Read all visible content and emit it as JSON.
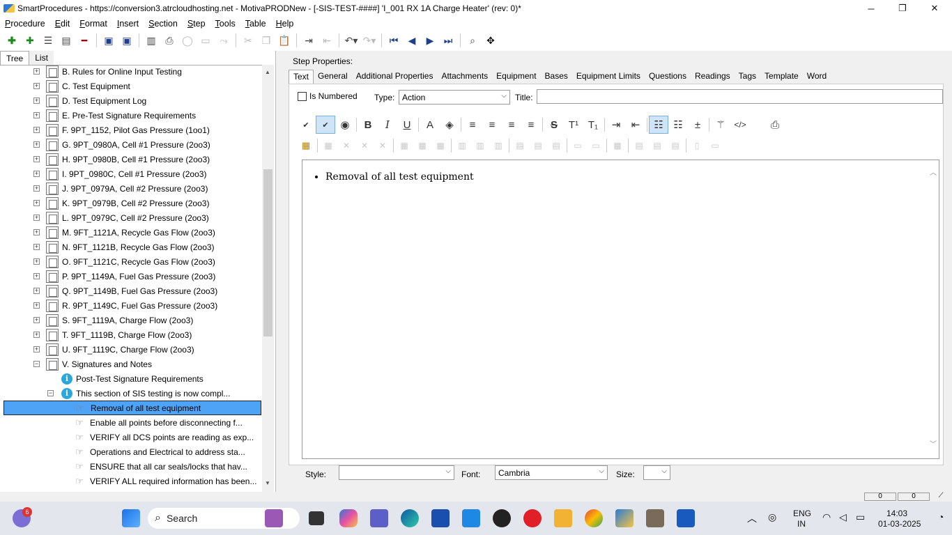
{
  "window": {
    "title": "SmartProcedures - https://conversion3.atrcloudhosting.net - MotivaPRODNew - [-SIS-TEST-####] 'I_001 RX 1A Charge Heater' (rev: 0)*",
    "minimize": "─",
    "restore": "❐",
    "close": "✕"
  },
  "menu": [
    {
      "first": "P",
      "rest": "rocedure"
    },
    {
      "first": "E",
      "rest": "dit"
    },
    {
      "first": "F",
      "rest": "ormat"
    },
    {
      "first": "I",
      "rest": "nsert"
    },
    {
      "first": "S",
      "rest": "ection"
    },
    {
      "first": "S",
      "rest": "tep"
    },
    {
      "first": "T",
      "rest": "ools"
    },
    {
      "first": "T",
      "rest": "able"
    },
    {
      "first": "H",
      "rest": "elp"
    }
  ],
  "left_tabs": {
    "tree": "Tree",
    "list": "List"
  },
  "tree": {
    "sections": [
      "B. Rules for Online Input Testing",
      "C. Test Equipment",
      "D. Test Equipment Log",
      "E. Pre-Test Signature Requirements",
      "F. 9PT_1152, Pilot Gas Pressure (1oo1)",
      "G. 9PT_0980A, Cell #1 Pressure (2oo3)",
      "H. 9PT_0980B, Cell #1 Pressure (2oo3)",
      "I. 9PT_0980C, Cell #1 Pressure (2oo3)",
      "J. 9PT_0979A, Cell #2 Pressure (2oo3)",
      "K. 9PT_0979B, Cell #2 Pressure (2oo3)",
      "L. 9PT_0979C, Cell #2 Pressure (2oo3)",
      "M. 9FT_1121A, Recycle Gas Flow (2oo3)",
      "N. 9FT_1121B, Recycle Gas Flow (2oo3)",
      "O. 9FT_1121C, Recycle Gas Flow (2oo3)",
      "P. 9PT_1149A, Fuel Gas Pressure (2oo3)",
      "Q. 9PT_1149B, Fuel Gas Pressure (2oo3)",
      "R. 9PT_1149C, Fuel Gas Pressure (2oo3)",
      "S. 9FT_1119A, Charge Flow (2oo3)",
      "T. 9FT_1119B, Charge Flow (2oo3)",
      "U. 9FT_1119C, Charge Flow (2oo3)",
      "V. Signatures and Notes"
    ],
    "info_items": [
      "Post-Test Signature Requirements",
      "This section of SIS testing is now compl..."
    ],
    "steps": [
      "Removal of all test equipment",
      "Enable all points before disconnecting f...",
      "VERIFY all DCS points are reading as exp...",
      "Operations and Electrical to address sta...",
      "ENSURE that all car seals/locks that hav...",
      "VERIFY ALL required information has been..."
    ]
  },
  "step_properties": {
    "label": "Step Properties:",
    "tabs": [
      "Text",
      "General",
      "Additional Properties",
      "Attachments",
      "Equipment",
      "Bases",
      "Equipment Limits",
      "Questions",
      "Readings",
      "Tags",
      "Template",
      "Word"
    ],
    "is_numbered": "Is Numbered",
    "type_label": "Type:",
    "type_value": "Action",
    "title_label": "Title:",
    "title_value": "",
    "content": "Removal of all test equipment",
    "style_label": "Style:",
    "style_value": "",
    "font_label": "Font:",
    "font_value": "Cambria",
    "size_label": "Size:",
    "size_value": ""
  },
  "status": {
    "cell1": "0",
    "cell2": "0"
  },
  "taskbar": {
    "search": "Search",
    "notification_badge": "6",
    "lang_line1": "ENG",
    "lang_line2": "IN",
    "time": "14:03",
    "date": "01-03-2025"
  }
}
